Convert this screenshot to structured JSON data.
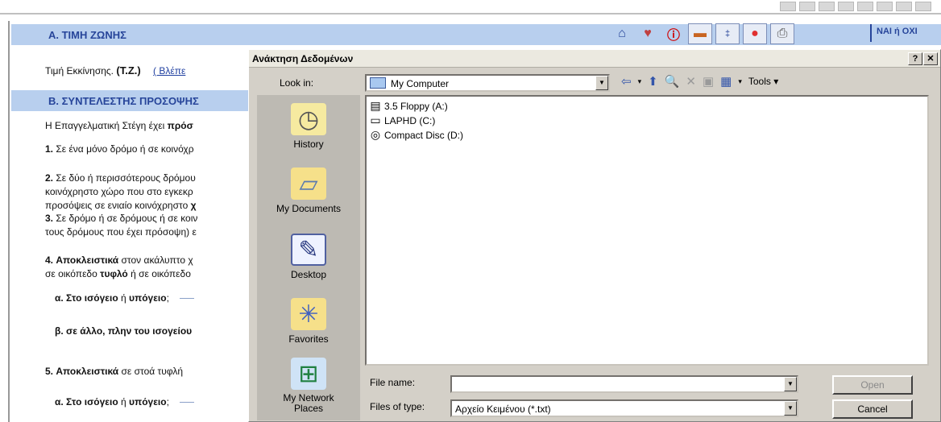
{
  "form": {
    "section_a_title": "Α. ΤΙΜΗ ΖΩΝΗΣ",
    "section_b_title": "Β. ΣΥΝΤΕΛΕΣΤΗΣ ΠΡΟΣΟΨΗΣ",
    "nai_oxi": "ΝΑΙ ή ΟΧΙ",
    "start_price_label": "Τιμή Εκκίνησης.",
    "start_price_abbr": "(Τ.Ζ.)",
    "see_link": "( Βλέπε",
    "line1_prefix": "Η Επαγγελματική Στέγη έχει",
    "line1_bold": "πρόσ",
    "item1_num": "1.",
    "item1_text": "Σε ένα μόνο δρόμο ή σε κοινόχρ",
    "item2_num": "2.",
    "item2_text_a": "Σε δύο ή περισσότερους δρόμου",
    "item2_text_b": "κοινόχρηστο χώρο που στο εγκεκρ",
    "item2_text_c": "προσόψεις σε ενιαίο κοινόχρηστο",
    "item2_text_c_bold": "χ",
    "item3_num": "3.",
    "item3_text_a": "Σε δρόμο ή σε δρόμους ή σε κοιν",
    "item3_text_b": "τους δρόμους που έχει πρόσοψη)",
    "item3_text_b_tail": "ε",
    "item4_num": "4.",
    "item4_bold": "Αποκλειστικά",
    "item4_text": "στον ακάλυπτο χ",
    "item4_line2_prefix": "σε οικόπεδο",
    "item4_line2_bold": "τυφλό",
    "item4_line2_suffix": "ή σε οικόπεδο",
    "sub_a_prefix": "α. Στο",
    "sub_a_bold1": "ισόγειο",
    "sub_a_mid": "ή",
    "sub_a_bold2": "υπόγειο",
    "sub_a_suffix": ";",
    "sub_b_prefix": "β. σε",
    "sub_b_bold": "άλλο, πλην του ισογείου",
    "item5_num": "5.",
    "item5_bold": "Αποκλειστικά",
    "item5_text": "σε στοά τυφλή",
    "sub_a2_prefix": "α. Στο",
    "sub_a2_bold1": "ισόγειο",
    "sub_a2_mid": "ή",
    "sub_a2_bold2": "υπόγειο",
    "sub_a2_suffix": ";"
  },
  "dialog": {
    "title": "Ανάκτηση Δεδομένων",
    "help_btn": "?",
    "close_btn": "✕",
    "look_in_label": "Look in:",
    "look_in_value": "My Computer",
    "tools_label": "Tools",
    "places": [
      {
        "label": "History",
        "icon": "history-icon"
      },
      {
        "label": "My Documents",
        "icon": "folder-icon"
      },
      {
        "label": "Desktop",
        "icon": "desktop-icon"
      },
      {
        "label": "Favorites",
        "icon": "favorites-icon"
      },
      {
        "label": "My Network Places",
        "icon": "network-icon"
      }
    ],
    "files": [
      {
        "name": "3.5 Floppy (A:)",
        "icon": "floppy-icon"
      },
      {
        "name": "LAPHD (C:)",
        "icon": "harddisk-icon"
      },
      {
        "name": "Compact Disc (D:)",
        "icon": "cd-icon"
      }
    ],
    "file_name_label": "File name:",
    "file_name_value": "",
    "files_of_type_label": "Files of type:",
    "files_of_type_value": "Αρχείο Κειμένου (*.txt)",
    "open_label": "Open",
    "cancel_label": "Cancel"
  }
}
